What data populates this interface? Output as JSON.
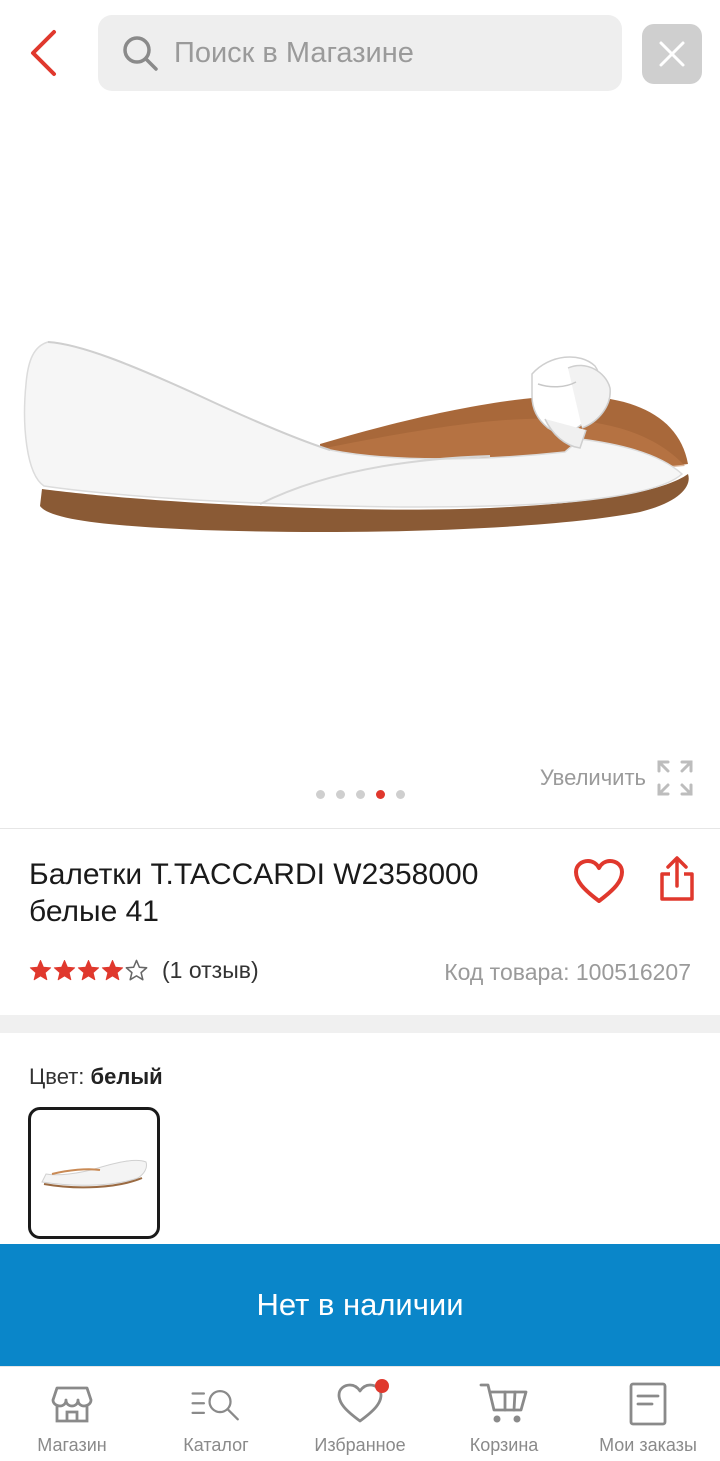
{
  "header": {
    "back_icon": "chevron-left-icon",
    "search_placeholder": "Поиск в Магазине",
    "search_icon": "search-icon",
    "clear_icon": "close-icon",
    "accent_color": "#e0382d"
  },
  "gallery": {
    "zoom_label": "Увеличить",
    "zoom_icon": "expand-icon",
    "page_count": 5,
    "active_page": 4
  },
  "product": {
    "title": "Балетки T.TACCARDI W2358000 белые 41",
    "rating": 4,
    "rating_max": 5,
    "reviews_label": "(1 отзыв)",
    "sku_label": "Код товара: 100516207",
    "favorite_icon": "heart-icon",
    "share_icon": "share-icon"
  },
  "color": {
    "label": "Цвет:",
    "value": "белый"
  },
  "action": {
    "label": "Нет в наличии",
    "color": "#0a86c9"
  },
  "nav": {
    "items": [
      {
        "label": "Магазин",
        "icon": "store-icon"
      },
      {
        "label": "Каталог",
        "icon": "catalog-search-icon"
      },
      {
        "label": "Избранное",
        "icon": "heart-icon",
        "badge": true
      },
      {
        "label": "Корзина",
        "icon": "cart-icon"
      },
      {
        "label": "Мои заказы",
        "icon": "orders-icon"
      }
    ]
  }
}
